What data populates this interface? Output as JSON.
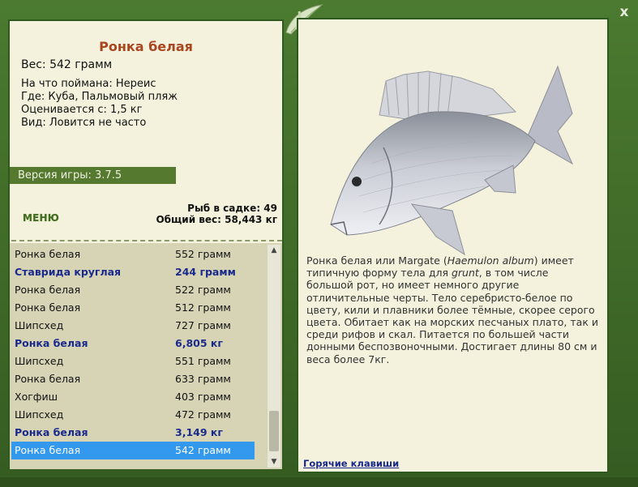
{
  "close_label": "x",
  "fish": {
    "title": "Ронка белая",
    "weight": "Вес: 542 грамм",
    "caught_on": "На что поймана: Нереис",
    "where": "Где: Куба, Пальмовый пляж",
    "rated_from": "Оценивается с: 1,5 кг",
    "kind": "Вид: Ловится не часто"
  },
  "version": "Версия игры: 3.7.5",
  "menu_label": "МЕНЮ",
  "stats": {
    "fish_in_cage": "Рыб в садке: 49",
    "total_weight": "Общий вес: 58,443 кг"
  },
  "catch_list": [
    {
      "name": "Ронка белая",
      "weight": "552 грамм",
      "bold": false
    },
    {
      "name": "Ставрида круглая",
      "weight": "244 грамм",
      "bold": true
    },
    {
      "name": "Ронка белая",
      "weight": "522 грамм",
      "bold": false
    },
    {
      "name": "Ронка белая",
      "weight": "512 грамм",
      "bold": false
    },
    {
      "name": "Шипсхед",
      "weight": "727 грамм",
      "bold": false
    },
    {
      "name": "Ронка белая",
      "weight": "6,805 кг",
      "bold": true
    },
    {
      "name": "Шипсхед",
      "weight": "551 грамм",
      "bold": false
    },
    {
      "name": "Ронка белая",
      "weight": "633 грамм",
      "bold": false
    },
    {
      "name": "Хогфиш",
      "weight": "403 грамм",
      "bold": false
    },
    {
      "name": "Шипсхед",
      "weight": "472 грамм",
      "bold": false
    },
    {
      "name": "Ронка белая",
      "weight": "3,149 кг",
      "bold": true
    },
    {
      "name": "Ронка белая",
      "weight": "542 грамм",
      "bold": false,
      "selected": true
    }
  ],
  "description": {
    "part1": "Ронка белая или Margate (",
    "latin": "Haemulon album",
    "part2": ") имеет типичную форму тела для ",
    "grunt": "grunt",
    "part3": ", в том числе большой рот, но имеет немного другие отличительные черты. Тело серебристо-белое по цвету, кили и плавники более тёмные, скорее серого цвета. Обитает как на морских песчаных плато, так и среди рифов и скал. Питается по большей части донными беспозвоночными. Достигает длины 80 см и веса более 7кг."
  },
  "hotkeys_label": "Горячие клавиши",
  "icons": {
    "close": "close-icon",
    "leaf": "leaf-decoration-icon",
    "scroll_up": "scroll-up-icon",
    "scroll_down": "scroll-down-icon"
  },
  "colors": {
    "frame_green": "#3e6827",
    "panel_bg": "#f4f1dc",
    "title_orange": "#a9461f",
    "highlight_blue": "#3399ee",
    "bold_blue": "#1a2a8c"
  }
}
